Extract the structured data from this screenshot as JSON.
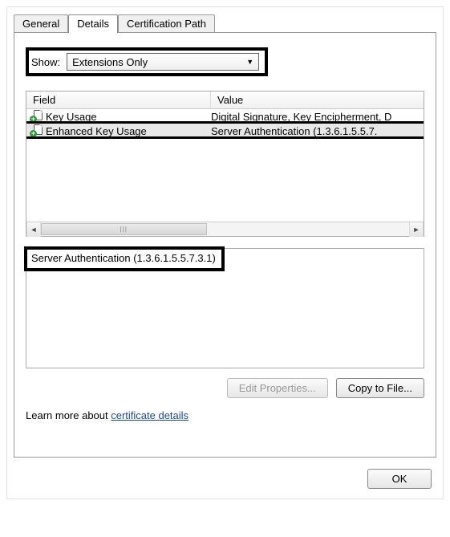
{
  "tabs": {
    "general": "General",
    "details": "Details",
    "certpath": "Certification Path"
  },
  "show": {
    "label": "Show:",
    "value": "Extensions Only"
  },
  "columns": {
    "field": "Field",
    "value": "Value"
  },
  "rows": [
    {
      "field": "Key Usage",
      "value": "Digital Signature, Key Encipherment, D"
    },
    {
      "field": "Enhanced Key Usage",
      "value": "Server Authentication (1.3.6.1.5.5.7."
    }
  ],
  "detail_text": "Server Authentication (1.3.6.1.5.5.7.3.1)",
  "buttons": {
    "edit": "Edit Properties...",
    "copy": "Copy to File...",
    "ok": "OK"
  },
  "learn": {
    "prefix": "Learn more about ",
    "link": "certificate details"
  }
}
